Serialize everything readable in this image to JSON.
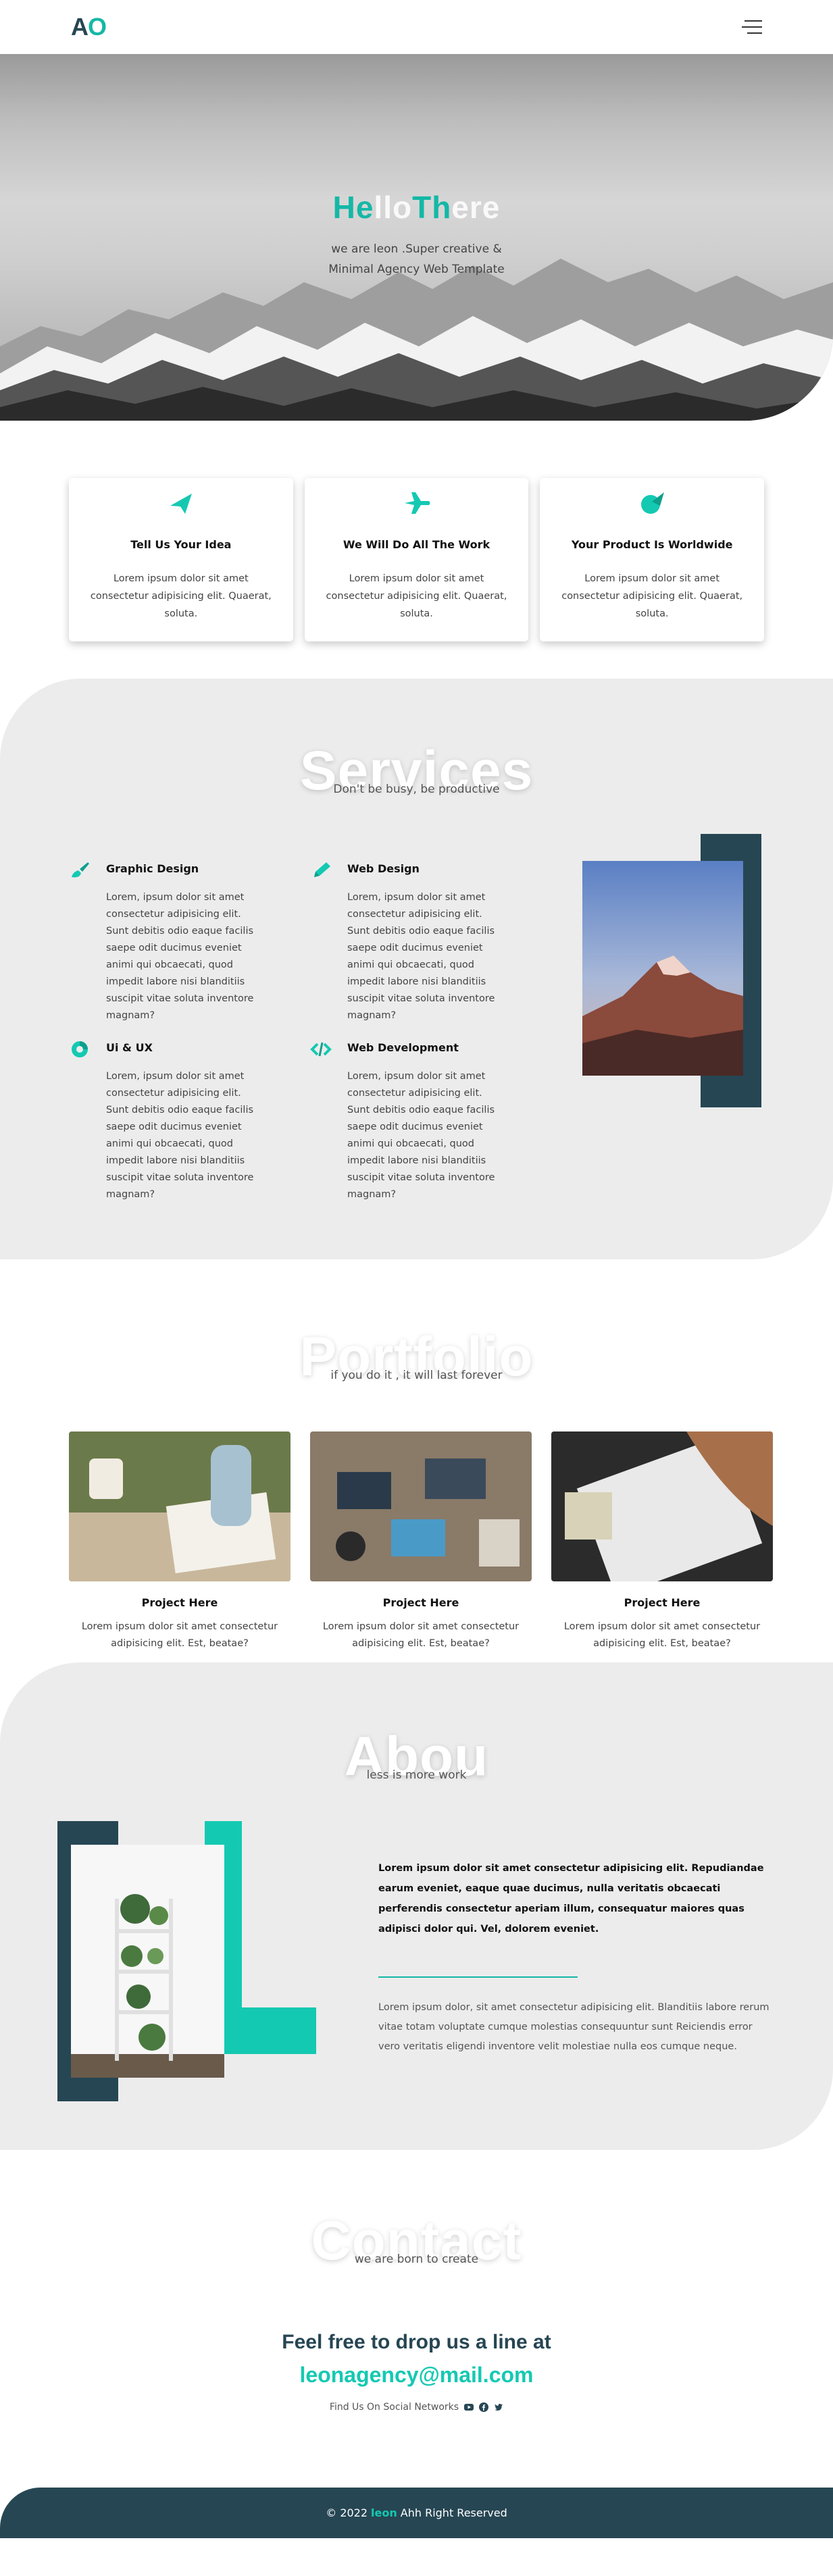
{
  "nav": {
    "logo_a": "A",
    "logo_o": "O"
  },
  "hero": {
    "title_he": "He",
    "title_llo": "llo",
    "title_th": "Th",
    "title_ere": "ere",
    "subtitle_line1": "we are leon .Super creative &",
    "subtitle_line2": "Minimal Agency Web Template"
  },
  "features": [
    {
      "icon": "paper-plane-icon",
      "title": "Tell Us Your Idea",
      "text": "Lorem ipsum dolor sit amet consectetur adipisicing elit. Quaerat, soluta."
    },
    {
      "icon": "airplane-icon",
      "title": "We Will Do All The Work",
      "text": "Lorem ipsum dolor sit amet consectetur adipisicing elit. Quaerat, soluta."
    },
    {
      "icon": "globe-plane-icon",
      "title": "Your Product Is Worldwide",
      "text": "Lorem ipsum dolor sit amet consectetur adipisicing elit. Quaerat, soluta."
    }
  ],
  "services": {
    "title": "Services",
    "subtitle": "Don't be busy, be productive",
    "items": [
      {
        "icon": "brush-icon",
        "title": "Graphic Design",
        "text": "Lorem, ipsum dolor sit amet consectetur adipisicing elit. Sunt debitis odio eaque facilis saepe odit ducimus eveniet animi qui obcaecati, quod impedit labore nisi blanditiis suscipit vitae soluta inventore magnam?"
      },
      {
        "icon": "pen-icon",
        "title": "Web Design",
        "text": "Lorem, ipsum dolor sit amet consectetur adipisicing elit. Sunt debitis odio eaque facilis saepe odit ducimus eveniet animi qui obcaecati, quod impedit labore nisi blanditiis suscipit vitae soluta inventore magnam?"
      },
      {
        "icon": "palette-icon",
        "title": "Ui & UX",
        "text": "Lorem, ipsum dolor sit amet consectetur adipisicing elit. Sunt debitis odio eaque facilis saepe odit ducimus eveniet animi qui obcaecati, quod impedit labore nisi blanditiis suscipit vitae soluta inventore magnam?"
      },
      {
        "icon": "code-icon",
        "title": "Web Development",
        "text": "Lorem, ipsum dolor sit amet consectetur adipisicing elit. Sunt debitis odio eaque facilis saepe odit ducimus eveniet animi qui obcaecati, quod impedit labore nisi blanditiis suscipit vitae soluta inventore magnam?"
      }
    ]
  },
  "portfolio": {
    "title": "Portfolio",
    "subtitle": "if you do it , it will last forever",
    "items": [
      {
        "title": "Project Here",
        "text": "Lorem ipsum dolor sit amet consectetur adipisicing elit. Est, beatae?"
      },
      {
        "title": "Project Here",
        "text": "Lorem ipsum dolor sit amet consectetur adipisicing elit. Est, beatae?"
      },
      {
        "title": "Project Here",
        "text": "Lorem ipsum dolor sit amet consectetur adipisicing elit. Est, beatae?"
      }
    ]
  },
  "about": {
    "title": "Abou",
    "subtitle": "less is more work",
    "bold_text": "Lorem ipsum dolor sit amet consectetur adipisicing elit. Repudiandae earum eveniet, eaque quae ducimus, nulla veritatis obcaecati perferendis consectetur aperiam illum, consequatur maiores quas adipisci dolor qui. Vel, dolorem eveniet.",
    "text": "Lorem ipsum dolor, sit amet consectetur adipisicing elit. Blanditiis labore rerum vitae totam voluptate cumque molestias consequuntur sunt Reiciendis error vero veritatis eligendi inventore velit molestiae nulla eos cumque neque."
  },
  "contact": {
    "title": "Contact",
    "subtitle": "we are born to create",
    "cta": "Feel free to drop us a line at",
    "email": "leonagency@mail.com",
    "social_label": "Find Us On Social Networks"
  },
  "footer": {
    "prefix": "© 2022",
    "brand": "leon",
    "suffix": "Ahh Right Reserved"
  },
  "colors": {
    "teal": "#14c9b2",
    "navy": "#264653",
    "gray_bg": "#ececec"
  }
}
